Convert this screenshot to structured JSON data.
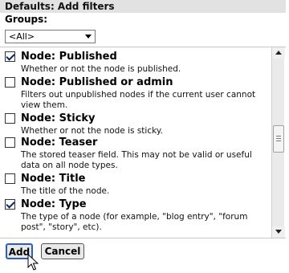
{
  "window": {
    "title": "Defaults: Add filters"
  },
  "groups": {
    "label": "Groups:",
    "selected": "<All>"
  },
  "filters": [
    {
      "title": "Node: Published",
      "description": "Whether or not the node is published.",
      "checked": true
    },
    {
      "title": "Node: Published or admin",
      "description": "Filters out unpublished nodes if the current user cannot view them.",
      "checked": false
    },
    {
      "title": "Node: Sticky",
      "description": "Whether or not the node is sticky.",
      "checked": false
    },
    {
      "title": "Node: Teaser",
      "description": "The stored teaser field. This may not be valid or useful data on all node types.",
      "checked": false
    },
    {
      "title": "Node: Title",
      "description": "The title of the node.",
      "checked": false
    },
    {
      "title": "Node: Type",
      "description": "The type of a node (for example, \"blog entry\", \"forum post\", \"story\", etc).",
      "checked": true
    }
  ],
  "buttons": {
    "add": "Add",
    "cancel": "Cancel"
  },
  "colors": {
    "title_bg": "#e2e2e2",
    "checkmark": "#0a246a",
    "add_focus": "#2a5ec7"
  }
}
